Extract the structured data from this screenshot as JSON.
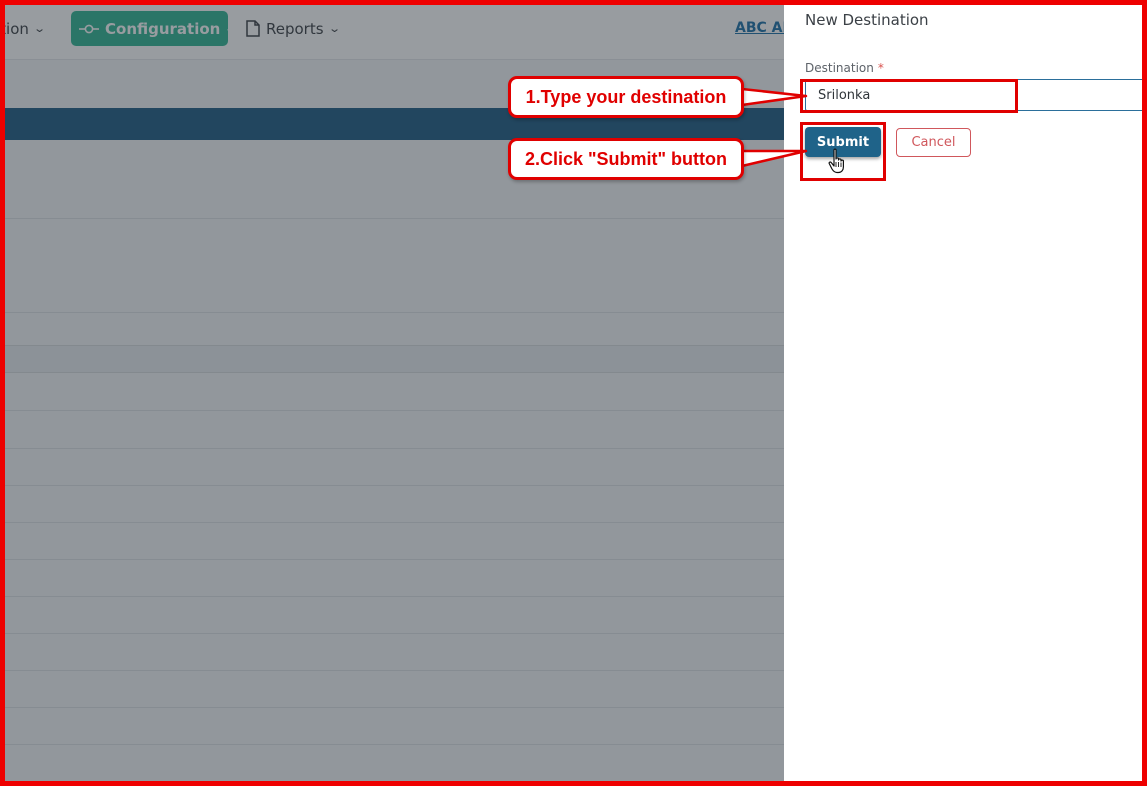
{
  "nav": {
    "items": [
      {
        "label": "ition",
        "icon": "none"
      },
      {
        "label": "Configuration",
        "icon": "configuration-icon"
      },
      {
        "label": "Reports",
        "icon": "document-icon"
      }
    ],
    "account_link": "ABC AF"
  },
  "panel": {
    "title": "New Destination",
    "field_label": "Destination",
    "required_marker": "*",
    "field_value": "Srilonka",
    "submit_label": "Submit",
    "cancel_label": "Cancel"
  },
  "annotations": {
    "step1": "1.Type your destination",
    "step2": "2.Click \"Submit\" button",
    "color": "#e00000"
  },
  "colors": {
    "config_button": "#2fb592",
    "submit_button": "#1f6389",
    "cancel_text": "#d0575c",
    "header_bar": "#1e5a82"
  }
}
